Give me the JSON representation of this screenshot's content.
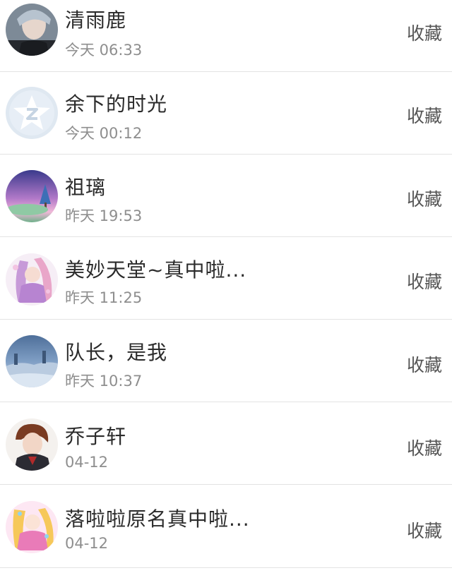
{
  "favorites": [
    {
      "name": "清雨鹿",
      "time": "今天 06:33",
      "action": "收藏",
      "avatar": "user-photo-icon"
    },
    {
      "name": "余下的时光",
      "time": "今天 00:12",
      "action": "收藏",
      "avatar": "default-qq-avatar-icon"
    },
    {
      "name": "祖璃",
      "time": "昨天 19:53",
      "action": "收藏",
      "avatar": "landscape-tree-icon"
    },
    {
      "name": "美妙天堂~真中啦...",
      "time": "昨天 11:25",
      "action": "收藏",
      "avatar": "anime-girl-icon"
    },
    {
      "name": "队长，是我",
      "time": "昨天 10:37",
      "action": "收藏",
      "avatar": "snow-landscape-icon"
    },
    {
      "name": "乔子轩",
      "time": "04-12",
      "action": "收藏",
      "avatar": "anime-boy-icon"
    },
    {
      "name": "落啦啦原名真中啦...",
      "time": "04-12",
      "action": "收藏",
      "avatar": "anime-idol-icon"
    }
  ],
  "colors": {
    "name_text": "#2b2b2b",
    "time_text": "#8e8e8e",
    "action_text": "#555555",
    "divider": "#e3e3e3"
  }
}
